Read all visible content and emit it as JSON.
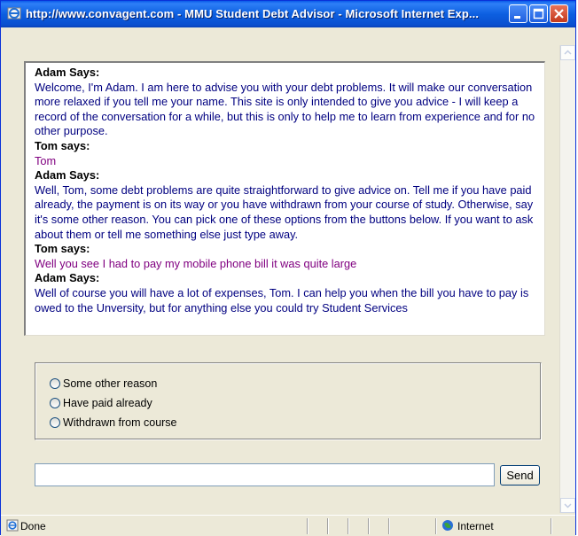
{
  "window": {
    "title": "http://www.convagent.com - MMU Student Debt Advisor - Microsoft Internet Exp...",
    "minimize_icon": "minimize-icon",
    "maximize_icon": "maximize-icon",
    "close_icon": "close-icon"
  },
  "chat": {
    "messages": [
      {
        "speaker": "Adam Says:",
        "role": "agent",
        "text": "Welcome, I'm Adam. I am here to advise you with your debt problems. It will make our conversation more relaxed if you tell me your name. This site is only intended to give you advice - I will keep a record of the conversation for a while, but this is only to help me to learn from experience and for no other purpose."
      },
      {
        "speaker": "Tom says:",
        "role": "user",
        "text": "Tom"
      },
      {
        "speaker": "Adam Says:",
        "role": "agent",
        "text": "Well, Tom, some debt problems are quite straightforward to give advice on. Tell me if you have paid already, the payment is on its way or you have withdrawn from your course of study. Otherwise, say it's some other reason. You can pick one of these options from the buttons below. If you want to ask about them or tell me something else just type away."
      },
      {
        "speaker": "Tom says:",
        "role": "user",
        "text": "Well you see I had to pay my mobile phone bill it was quite large"
      },
      {
        "speaker": "Adam Says:",
        "role": "agent",
        "text": "Well of course you will have a lot of expenses, Tom. I can help you when the bill you have to pay is owed to the Unversity, but for anything else you could try Student Services"
      }
    ]
  },
  "options": [
    {
      "label": "Some other reason",
      "selected": false
    },
    {
      "label": "Have paid already",
      "selected": false
    },
    {
      "label": "Withdrawn from course",
      "selected": false
    }
  ],
  "input": {
    "value": "",
    "send_label": "Send"
  },
  "status": {
    "left_text": "Done",
    "zone_text": "Internet"
  },
  "colors": {
    "titlebar": "#0a5ae8",
    "agent_text": "#000080",
    "user_text": "#800080"
  }
}
